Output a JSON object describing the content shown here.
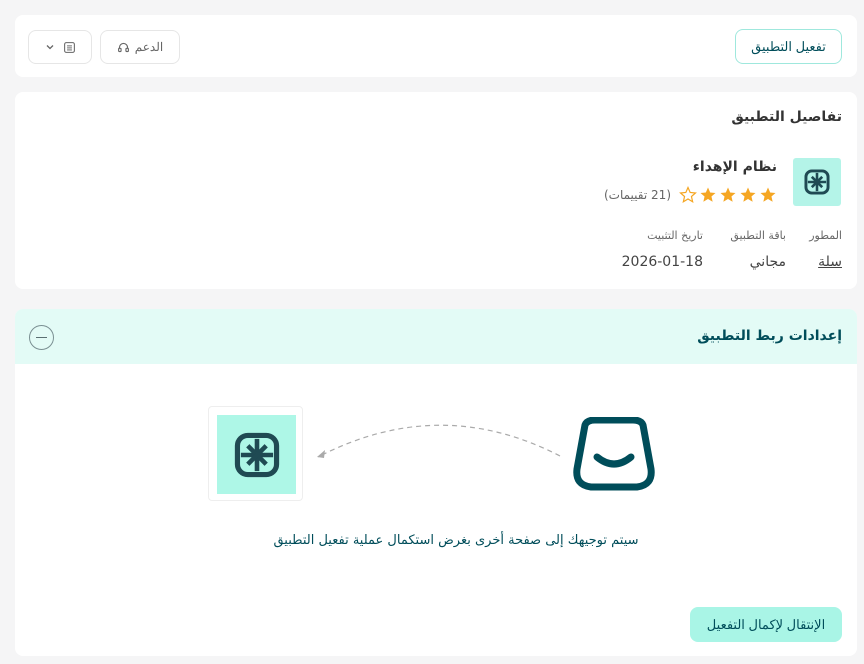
{
  "topbar": {
    "activate_label": "تفعيل التطبيق",
    "support_label": "الدعم"
  },
  "details": {
    "title": "تفاصيل التطبيق",
    "app_name": "نظام الإهداء",
    "rating": 4,
    "rating_max": 5,
    "rating_text": "(21 تقييمات)",
    "developer_label": "المطور",
    "developer_value": "سلة",
    "plan_label": "باقة التطبيق",
    "plan_value": "مجاني",
    "install_label": "تاريخ التثبيت",
    "install_value": "2026-01-18"
  },
  "integration": {
    "title": "إعدادات ربط التطبيق",
    "redirect_message": "سيتم توجيهك إلى صفحة أخرى بغرض استكمال عملية تفعيل التطبيق",
    "proceed_label": "الإنتقال لإكمال التفعيل"
  },
  "colors": {
    "brand_dark": "#004d5a",
    "accent_mint": "#aef7e7",
    "header_bg": "#e3fbf6",
    "star": "#f5a623"
  }
}
